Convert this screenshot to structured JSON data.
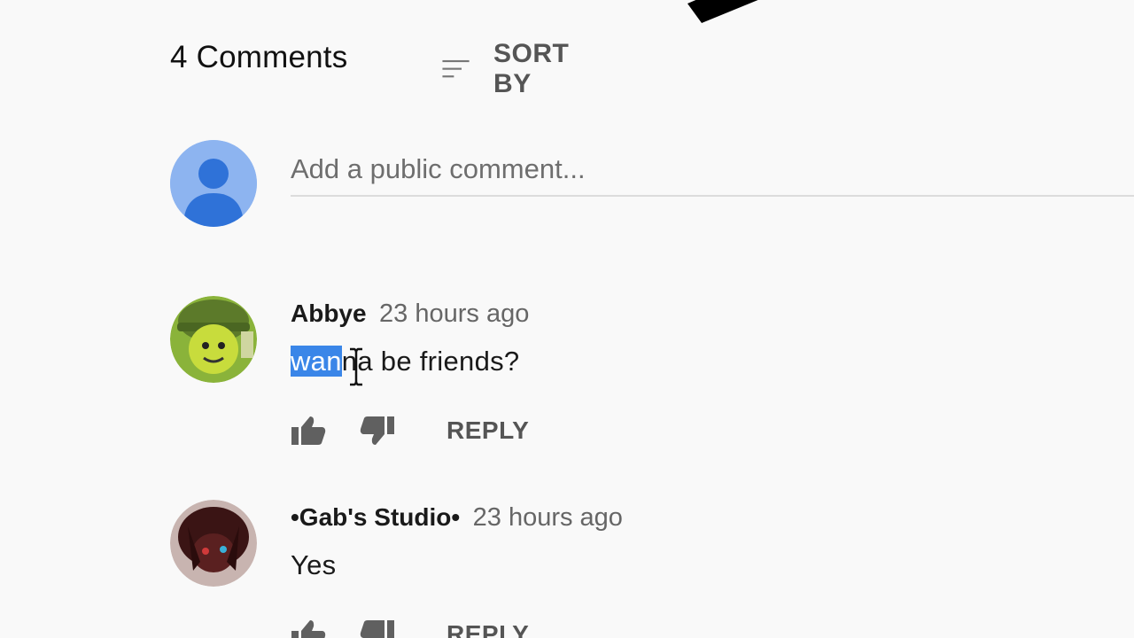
{
  "header": {
    "comment_count": "4 Comments",
    "sort_label": "SORT BY",
    "sort_icon": "sort-icon"
  },
  "add_comment": {
    "placeholder": "Add a public comment...",
    "avatar_icon": "default-user-avatar-icon",
    "avatar_color": "#8db4f0"
  },
  "comments": [
    {
      "author": "Abbye",
      "time": "23 hours ago",
      "text_selected": "wan",
      "text_rest": "na be friends?",
      "reply_label": "REPLY",
      "like_icon": "thumb-up-icon",
      "dislike_icon": "thumb-down-icon"
    },
    {
      "author": "•Gab's Studio•",
      "time": "23 hours ago",
      "text": "Yes",
      "reply_label": "REPLY",
      "like_icon": "thumb-up-icon",
      "dislike_icon": "thumb-down-icon"
    }
  ],
  "colors": {
    "background": "#f9f9f9",
    "selection": "#3a86e8",
    "muted_text": "#666666"
  }
}
